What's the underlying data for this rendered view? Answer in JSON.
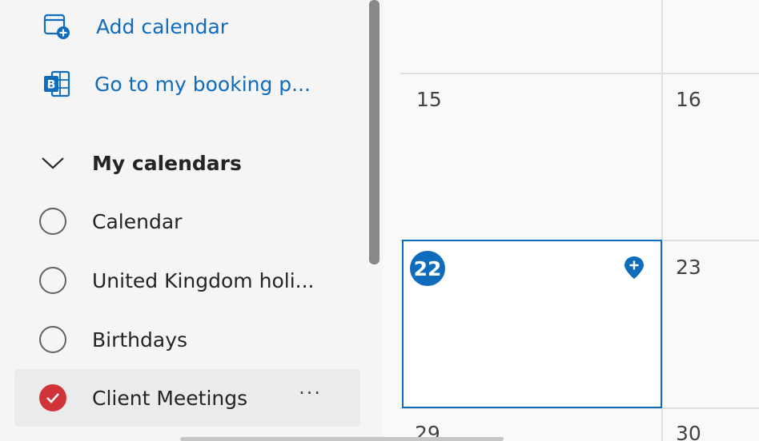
{
  "sidebar": {
    "add_calendar_label": "Add calendar",
    "booking_label": "Go to my booking p...",
    "section_title": "My calendars",
    "items": [
      {
        "label": "Calendar",
        "checked": false
      },
      {
        "label": "United Kingdom holi...",
        "checked": false
      },
      {
        "label": "Birthdays",
        "checked": false
      },
      {
        "label": "Client Meetings",
        "checked": true,
        "more": "···",
        "color": "#d13438"
      }
    ]
  },
  "grid": {
    "days": {
      "d15": "15",
      "d16": "16",
      "d22": "22",
      "d23": "23",
      "d29": "29",
      "d30": "30"
    },
    "today": "22"
  },
  "colors": {
    "accent": "#0f6cbd",
    "checked_calendar": "#d13438"
  }
}
